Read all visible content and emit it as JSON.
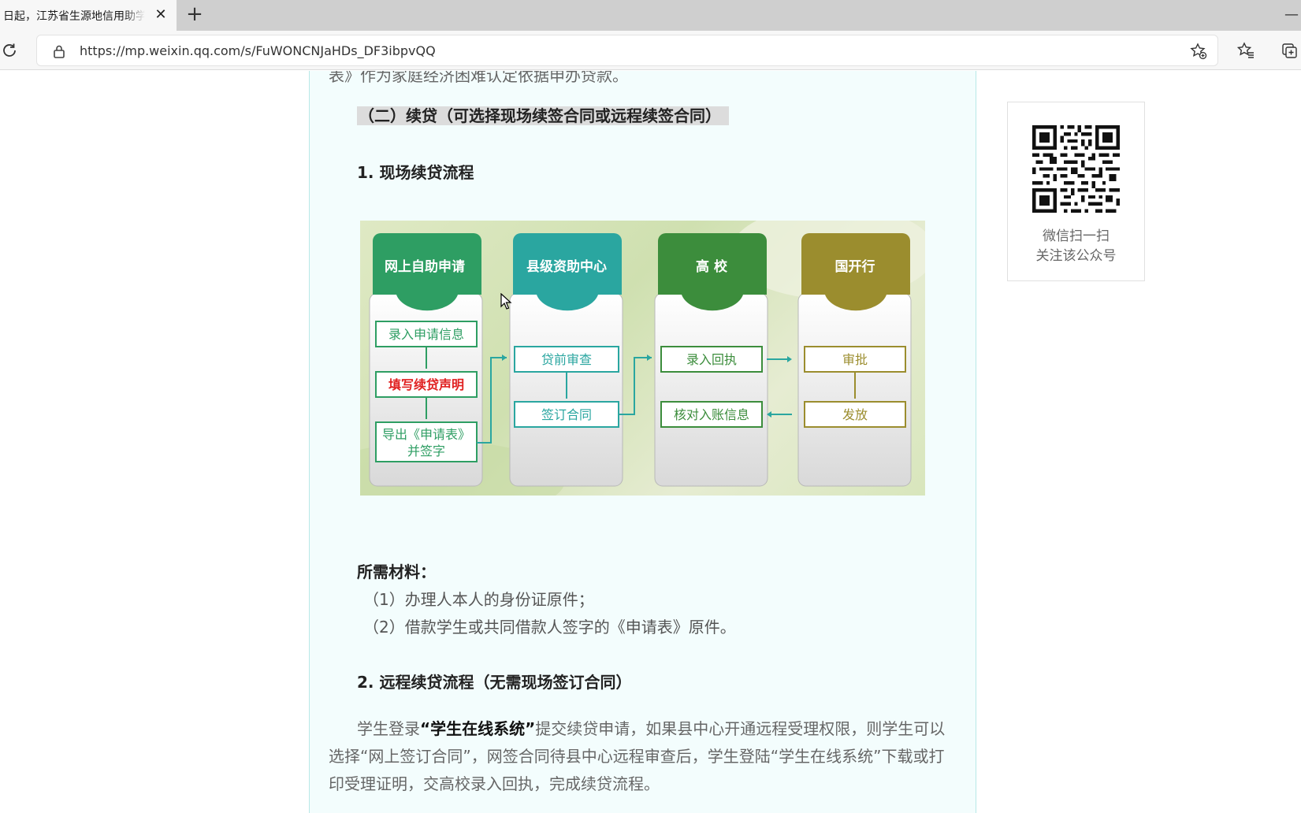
{
  "browser": {
    "tab_title": "日起，江苏省生源地信用助学贷款",
    "url": "https://mp.weixin.qq.com/s/FuWONCNJaHDs_DF3ibpvQQ"
  },
  "article": {
    "cut_line": "表》作为家庭经济困难认定依据申办贷款。",
    "section_heading": "（二）续贷（可选择现场续签合同或远程续签合同）",
    "step1_heading": "1. 现场续贷流程",
    "flow": {
      "columns": [
        {
          "title": "网上自助申请",
          "steps": [
            "录入申请信息",
            "填写续贷声明",
            "导出《申请表》",
            "并签字"
          ]
        },
        {
          "title": "县级资助中心",
          "steps": [
            "贷前审查",
            "签订合同"
          ]
        },
        {
          "title": "高  校",
          "steps": [
            "录入回执",
            "核对入账信息"
          ]
        },
        {
          "title": "国开行",
          "steps": [
            "审批",
            "发放"
          ]
        }
      ],
      "colors": {
        "green": "#2e9e63",
        "teal": "#2aa6a0",
        "dark_green": "#3c8d3c",
        "olive": "#9b8d2e",
        "red_text": "#e02020"
      }
    },
    "materials_title": "所需材料：",
    "materials": [
      "（1）办理人本人的身份证原件；",
      "（2）借款学生或共同借款人签字的《申请表》原件。"
    ],
    "step2_heading": "2. 远程续贷流程（无需现场签订合同）",
    "para_before": "学生登录",
    "para_bold": "“学生在线系统”",
    "para_after": "提交续贷申请，如果县中心开通远程受理权限，则学生可以选择“网上签订合同”，网签合同待县中心远程审查后，学生登陆“学生在线系统”下载或打印受理证明，交高校录入回执，完成续贷流程。"
  },
  "sidebar": {
    "qr_line1": "微信扫一扫",
    "qr_line2": "关注该公众号"
  }
}
